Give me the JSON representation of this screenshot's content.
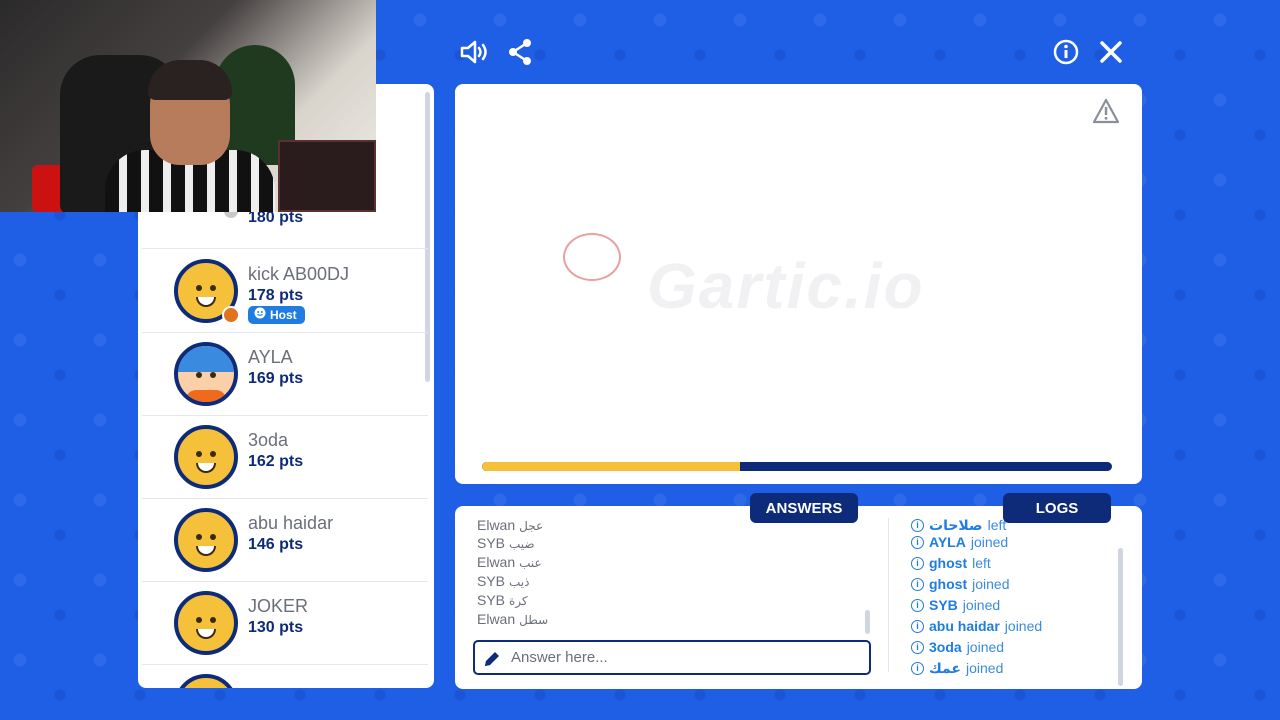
{
  "toolbar": {
    "sound_icon": "speaker-icon",
    "share_icon": "share-icon",
    "info_icon": "info-icon",
    "close_icon": "close-icon"
  },
  "players": [
    {
      "name": "",
      "points": "180 pts",
      "status_color": "#c8c8c8",
      "host": false
    },
    {
      "name": "kick AB00DJ",
      "points": "178 pts",
      "status_color": "#e0731e",
      "host": true,
      "host_label": "Host"
    },
    {
      "name": "AYLA",
      "points": "169 pts",
      "host": false
    },
    {
      "name": "3oda",
      "points": "162 pts",
      "host": false
    },
    {
      "name": "abu haidar",
      "points": "146 pts",
      "host": false
    },
    {
      "name": "JOKER",
      "points": "130 pts",
      "host": false
    }
  ],
  "canvas": {
    "watermark": "Gartic.io",
    "warning_icon": "warning-icon",
    "progress": 0.41
  },
  "tabs": {
    "answers": "ANSWERS",
    "logs": "LOGS"
  },
  "answers": [
    {
      "user": "Elwan",
      "word": "عجل"
    },
    {
      "user": "SYB",
      "word": "ضيب"
    },
    {
      "user": "Elwan",
      "word": "عنب"
    },
    {
      "user": "SYB",
      "word": "ذيب"
    },
    {
      "user": "SYB",
      "word": "كرة"
    },
    {
      "user": "Elwan",
      "word": "سطل"
    }
  ],
  "answer_input": {
    "placeholder": "Answer here..."
  },
  "logs": [
    {
      "user": "صلاحات",
      "action": "left"
    },
    {
      "user": "AYLA",
      "action": "joined"
    },
    {
      "user": "ghost",
      "action": "left"
    },
    {
      "user": "ghost",
      "action": "joined"
    },
    {
      "user": "SYB",
      "action": "joined"
    },
    {
      "user": "abu haidar",
      "action": "joined"
    },
    {
      "user": "3oda",
      "action": "joined"
    },
    {
      "user": "عمك",
      "action": "joined"
    }
  ],
  "colors": {
    "background": "#1e5fe6",
    "navy": "#0d2b78",
    "accent_yellow": "#f5c13a",
    "link_blue": "#1f7de0"
  }
}
